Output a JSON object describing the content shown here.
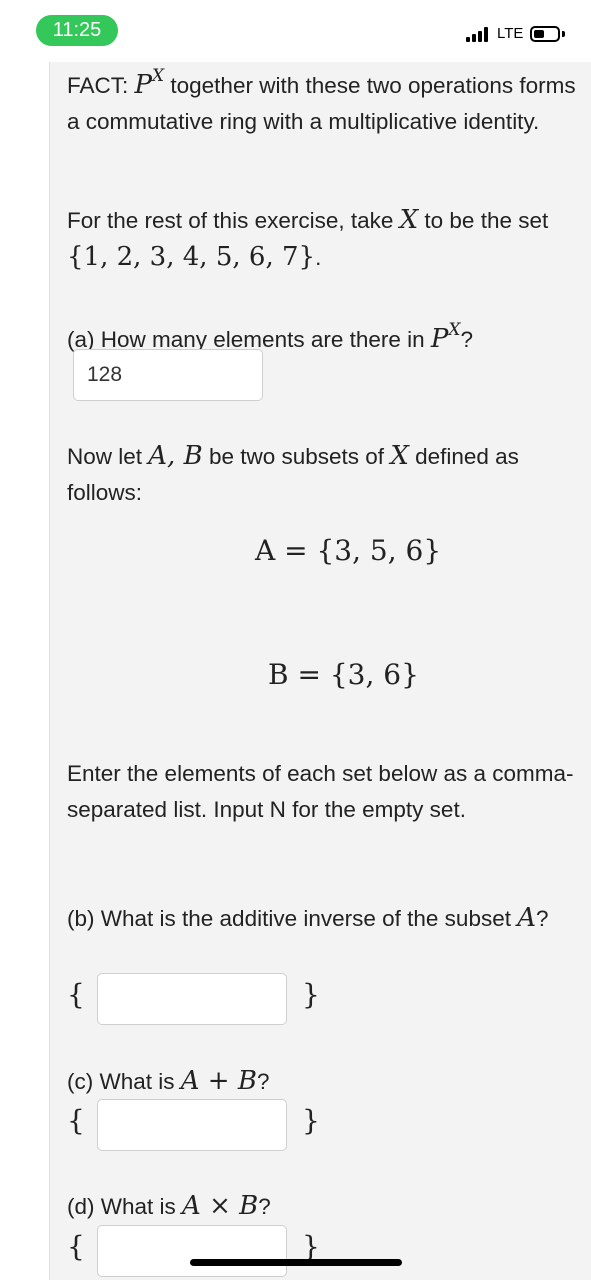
{
  "status": {
    "time": "11:25",
    "network": "LTE"
  },
  "content": {
    "fact_label": "FACT:",
    "fact_symbol": "P",
    "fact_sup": "X",
    "fact_rest": " together with these two operations forms a commutative ring with a multiplicative identity.",
    "rest_intro": "For the rest of this exercise, take ",
    "rest_var": "X",
    "rest_mid": " to be the set ",
    "rest_set": "{1, 2, 3, 4, 5, 6, 7}",
    "rest_end": ".",
    "q_a_text": "(a) How many elements are there in ",
    "q_a_symbol": "P",
    "q_a_sup": "X",
    "q_a_end": "?",
    "q_a_answer": "128",
    "subsets_intro": "Now let ",
    "subsets_vars": "A, B",
    "subsets_mid": " be two subsets of ",
    "subsets_var_x": "X",
    "subsets_end": " defined as follows:",
    "set_a_def": "A = {3, 5, 6}",
    "set_b_def": "B = {3, 6}",
    "instructions": "Enter the elements of each set below as a comma-separated list. Input N for the empty set.",
    "q_b_text": "(b) What is the additive inverse of the subset ",
    "q_b_var": "A",
    "q_b_end": "?",
    "q_c_text": "(c) What is ",
    "q_c_expr": "A + B",
    "q_c_end": "?",
    "q_d_text": "(d) What is ",
    "q_d_expr": "A × B",
    "q_d_end": "?",
    "open_brace": "{",
    "close_brace": "}"
  },
  "colors": {
    "time_pill": "#34c759",
    "panel_bg": "#f3f3f3"
  }
}
